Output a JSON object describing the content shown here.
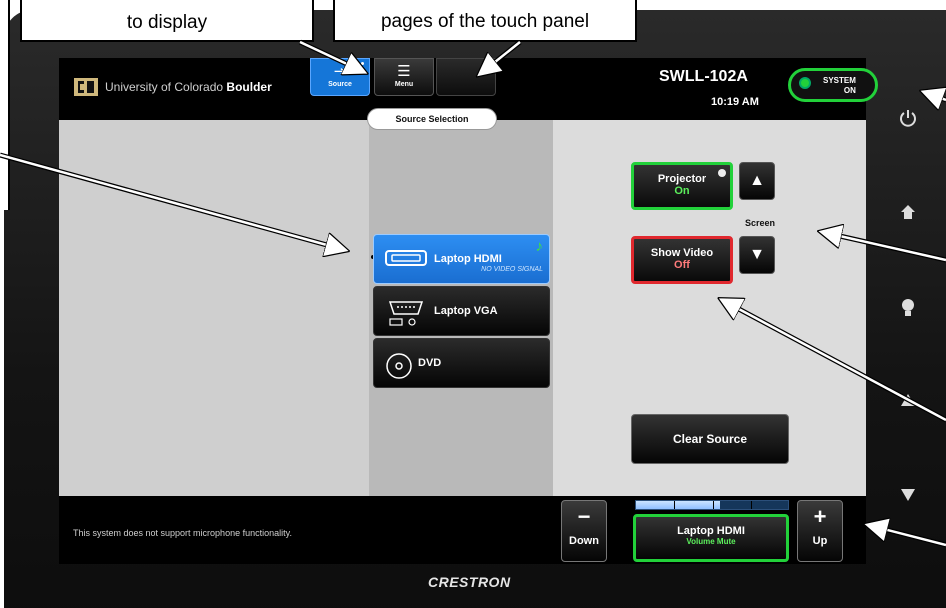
{
  "callouts": {
    "left": "to display",
    "right": "pages of the touch panel"
  },
  "header": {
    "university": "University of Colorado",
    "campus": "Boulder",
    "room": "SWLL-102A",
    "time": "10:19 AM",
    "system_line1": "SYSTEM",
    "system_line2": "ON"
  },
  "nav": {
    "source_label": "Source",
    "menu_label": "Menu"
  },
  "source_selection": {
    "title": "Source Selection",
    "items": [
      {
        "label": "Laptop HDMI",
        "status": "NO VIDEO SIGNAL",
        "icon": "hdmi-icon"
      },
      {
        "label": "Laptop VGA",
        "status": "",
        "icon": "vga-icon"
      },
      {
        "label": "DVD",
        "status": "",
        "icon": "dvd-icon"
      }
    ]
  },
  "controls": {
    "projector_label": "Projector",
    "projector_state": "On",
    "video_label": "Show Video",
    "video_state": "Off",
    "screen_label": "Screen",
    "clear_label": "Clear Source"
  },
  "audio": {
    "mic_note": "This system does not support microphone functionality.",
    "down_label": "Down",
    "up_label": "Up",
    "source_label": "Laptop HDMI",
    "mute_label": "Volume Mute",
    "volume_level": 0.55
  },
  "brand": "CRESTRON",
  "colors": {
    "accent_blue": "#1a6ed1",
    "active_green": "#22d13a",
    "alert_red": "#e0282e"
  }
}
